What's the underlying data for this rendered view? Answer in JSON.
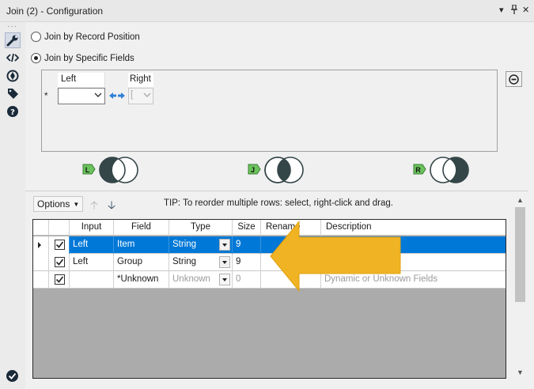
{
  "window": {
    "title": "Join (2) - Configuration",
    "controls": {
      "menu": "▾",
      "pin": "⊥",
      "close": "✕"
    }
  },
  "sidebar": {
    "dots": "···",
    "icons": [
      "wrench-icon",
      "code-icon",
      "target-icon",
      "tag-icon",
      "help-icon"
    ]
  },
  "join_mode": {
    "option_position": "Join by Record Position",
    "option_fields": "Join by Specific Fields",
    "selected": "fields"
  },
  "field_grid": {
    "row_marker": "*",
    "left_header": "Left",
    "right_header": "Right",
    "left_value": "",
    "right_value": "["
  },
  "venn": {
    "left_badge": "L",
    "join_badge": "J",
    "right_badge": "R",
    "fill": "#354648",
    "badge_color": "#6ac35b"
  },
  "toolbar": {
    "options_label": "Options",
    "tip": "TIP: To reorder multiple rows: select, right-click and drag."
  },
  "table": {
    "columns": [
      "Input",
      "Field",
      "Type",
      "Size",
      "Rename",
      "Description"
    ],
    "rows": [
      {
        "input": "Left",
        "field": "Item",
        "type": "String",
        "size": "9",
        "rename": "",
        "description": "",
        "selected": true
      },
      {
        "input": "Left",
        "field": "Group",
        "type": "String",
        "size": "9",
        "rename": "",
        "description": ""
      },
      {
        "input": "",
        "field": "*Unknown",
        "type": "Unknown",
        "size": "0",
        "rename": "",
        "description": "Dynamic or Unknown Fields",
        "dim": true
      }
    ]
  },
  "colors": {
    "selection": "#0078d7",
    "arrow": "#f0b323",
    "check": "#2e8b2e"
  }
}
